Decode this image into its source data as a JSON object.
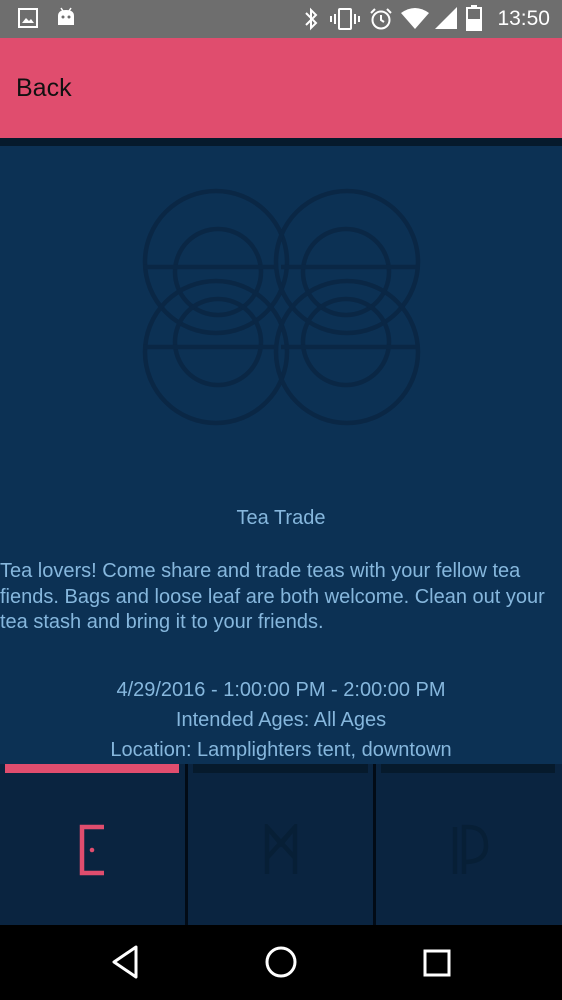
{
  "status_bar": {
    "time": "13:50",
    "left_icons": [
      "image-icon",
      "android-icon"
    ],
    "right_icons": [
      "bluetooth-icon",
      "vibrate-icon",
      "alarm-icon",
      "wifi-icon",
      "signal-icon",
      "battery-icon"
    ]
  },
  "app_bar": {
    "back_label": "Back",
    "color": "#e04d6e"
  },
  "event": {
    "title": "Tea Trade",
    "description": "Tea lovers! Come share and trade teas with your fellow tea fiends. Bags and loose leaf are both welcome. Clean out your tea stash and bring it to your friends.",
    "datetime": "4/29/2016 - 1:00:00 PM - 2:00:00 PM",
    "ages": "Intended Ages: All Ages",
    "location": "Location: Lamplighters tent, downtown"
  },
  "tabs": [
    {
      "icon": "e-rune-icon",
      "active": true
    },
    {
      "icon": "m-rune-icon",
      "active": false
    },
    {
      "icon": "p-rune-icon",
      "active": false
    }
  ],
  "nav_bar": {
    "buttons": [
      "back-triangle-icon",
      "home-circle-icon",
      "recents-square-icon"
    ]
  },
  "colors": {
    "background": "#0c3154",
    "text": "#86b7dd",
    "accent": "#e04d6e",
    "logo_stroke": "#0a2745"
  }
}
